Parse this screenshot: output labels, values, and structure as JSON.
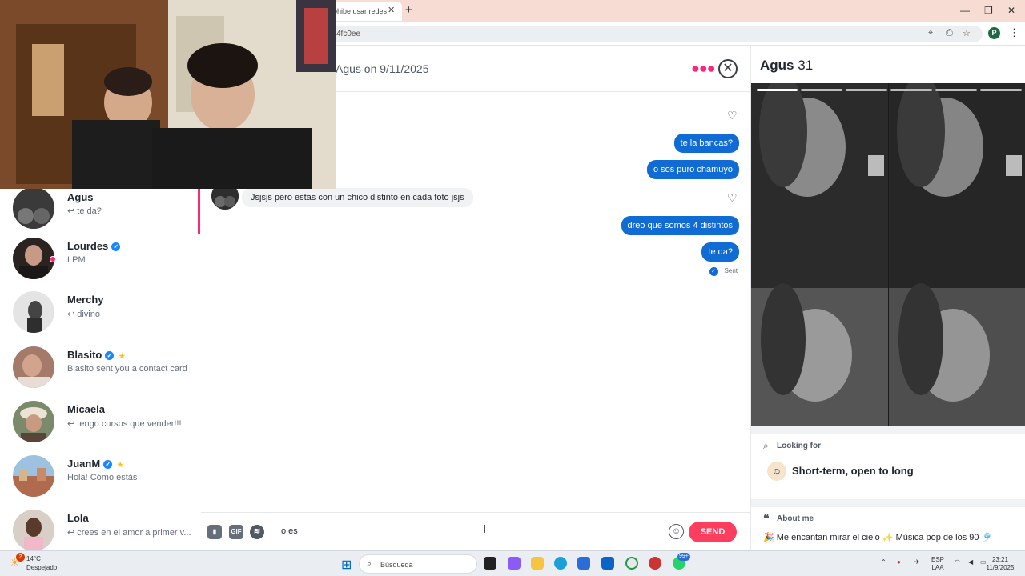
{
  "browser": {
    "tab_title": "ohibe usar redes",
    "url_fragment": "4fc0ee",
    "profile_initial": "P"
  },
  "sidebar": {
    "conversations": [
      {
        "name": "Agus",
        "last": "↩ te da?",
        "verified": false,
        "star": false
      },
      {
        "name": "Lourdes",
        "last": "LPM",
        "verified": true,
        "star": false
      },
      {
        "name": "Merchy",
        "last": "↩ divino",
        "verified": false,
        "star": false
      },
      {
        "name": "Blasito",
        "last": "Blasito sent you a contact card",
        "verified": true,
        "star": true
      },
      {
        "name": "Micaela",
        "last": "↩ tengo cursos que vender!!!",
        "verified": false,
        "star": false
      },
      {
        "name": "JuanM",
        "last": "Hola! Cómo estás",
        "verified": true,
        "star": true
      },
      {
        "name": "Lola",
        "last": "↩ crees en el amor a primer v...",
        "verified": false,
        "star": false
      }
    ]
  },
  "chat": {
    "header_title": "Agus on 9/11/2025",
    "messages": [
      {
        "dir": "out",
        "text": "te la bancas?"
      },
      {
        "dir": "out",
        "text": "o sos puro chamuyo"
      },
      {
        "dir": "in",
        "text": "Jsjsjs pero estas con un chico distinto en cada foto jsjs"
      },
      {
        "dir": "out",
        "text": "dreo que somos 4 distintos"
      },
      {
        "dir": "out",
        "text": "te da?"
      }
    ],
    "sent_label": "Sent",
    "composer_value": "o es",
    "gif_label": "GIF",
    "send_label": "SEND"
  },
  "profile": {
    "name": "Agus",
    "age": "31",
    "looking_for_label": "Looking for",
    "looking_for_value": "Short-term, open to long",
    "about_label": "About me",
    "about_text": "🎉 Me encantan mirar el cielo ✨ Música pop de los 90 🎐"
  },
  "taskbar": {
    "weather_temp": "14°C",
    "weather_desc": "Despejado",
    "search_placeholder": "Búsqueda",
    "lang": "ESP",
    "lang2": "LAA",
    "time": "23:21",
    "date": "11/9/2025",
    "weather_badge": "2",
    "whatsapp_badge": "99+"
  },
  "colors": {
    "accent": "#fd267a",
    "bubble": "#106bd5",
    "send": "#fd3e5e"
  }
}
